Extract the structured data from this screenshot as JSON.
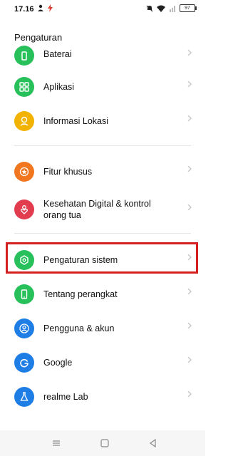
{
  "status_bar": {
    "time": "17.16",
    "battery": "97"
  },
  "header": {
    "title": "Pengaturan"
  },
  "items": [
    {
      "label": "Baterai",
      "icon": "battery-icon",
      "color": "#28c05a"
    },
    {
      "label": "Aplikasi",
      "icon": "apps-grid-icon",
      "color": "#28c05a"
    },
    {
      "label": "Informasi Lokasi",
      "icon": "location-icon",
      "color": "#f2b200"
    },
    {
      "label": "Fitur khusus",
      "icon": "star-icon",
      "color": "#f0771f"
    },
    {
      "label": "Kesehatan Digital & kontrol orang tua",
      "icon": "heart-person-icon",
      "color": "#e23c4f"
    },
    {
      "label": "Pengaturan sistem",
      "icon": "system-gear-icon",
      "color": "#28c05a"
    },
    {
      "label": "Tentang perangkat",
      "icon": "phone-icon",
      "color": "#28c05a"
    },
    {
      "label": "Pengguna & akun",
      "icon": "user-icon",
      "color": "#1f7ee6"
    },
    {
      "label": "Google",
      "icon": "google-icon",
      "color": "#1f7ee6"
    },
    {
      "label": "realme Lab",
      "icon": "flask-icon",
      "color": "#1f7ee6"
    }
  ],
  "highlight_color": "#d42020"
}
